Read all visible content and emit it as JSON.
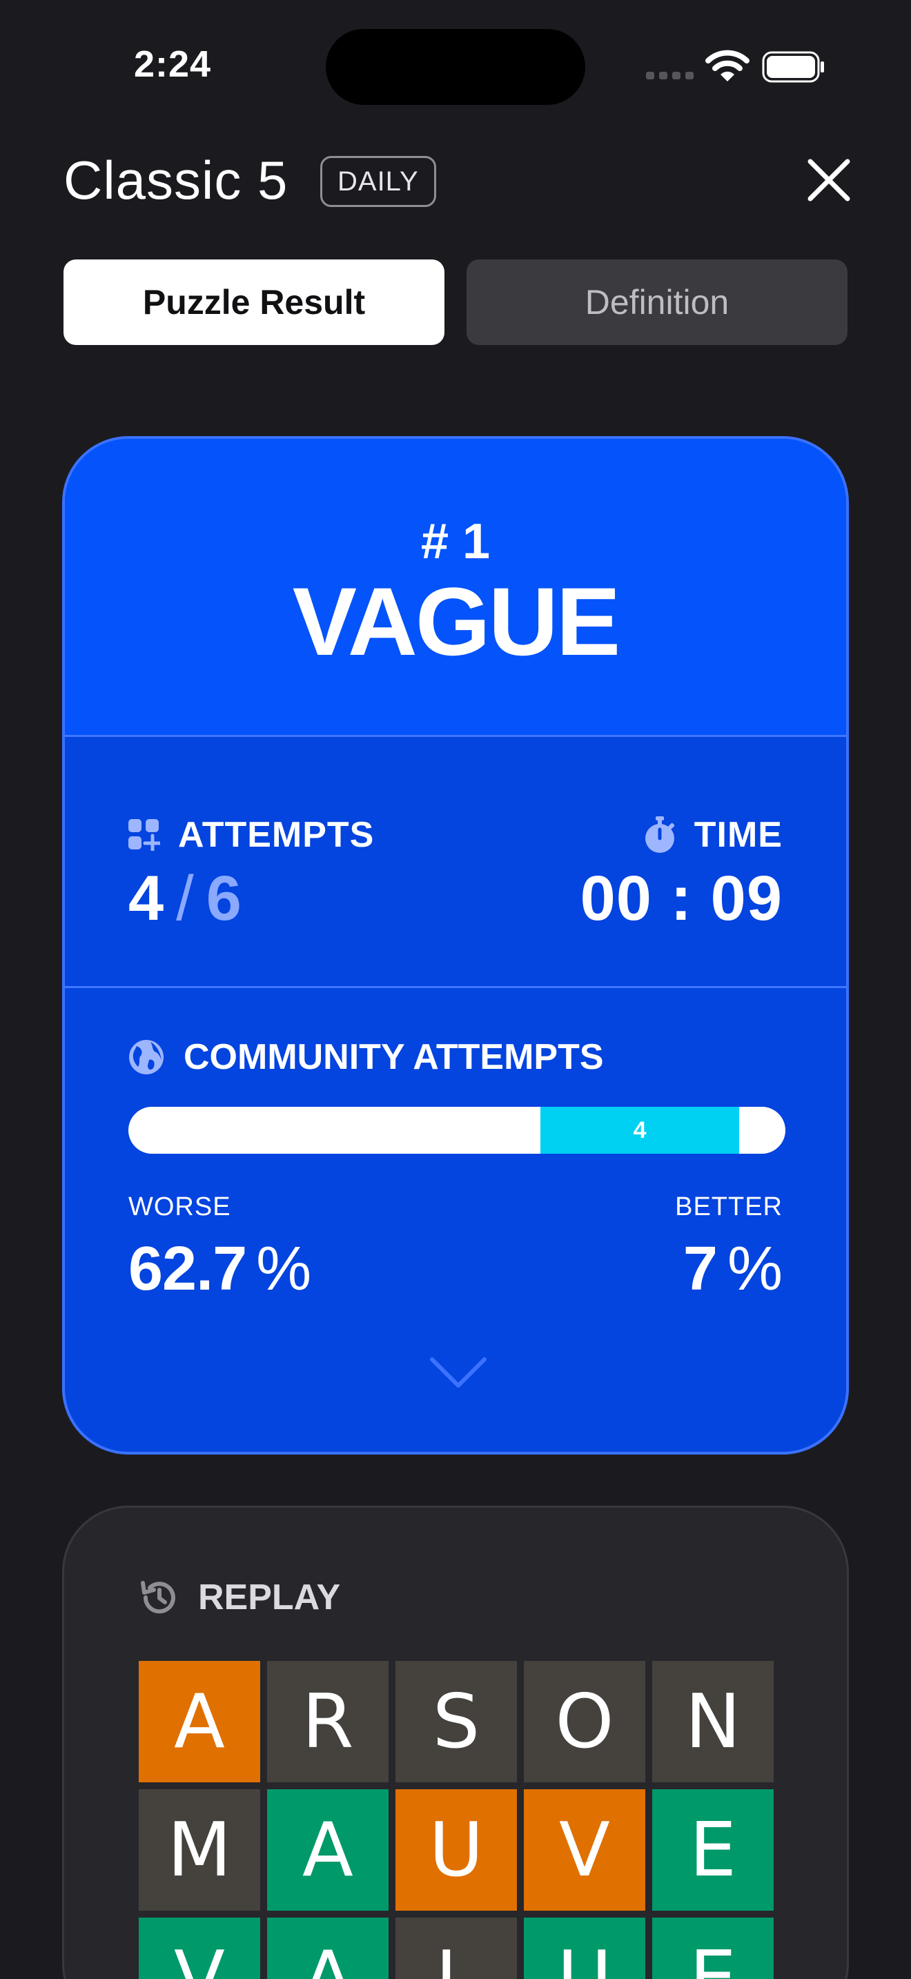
{
  "status_bar": {
    "time": "2:24"
  },
  "header": {
    "title": "Classic 5",
    "badge": "DAILY"
  },
  "tabs": [
    {
      "label": "Puzzle Result",
      "selected": true
    },
    {
      "label": "Definition",
      "selected": false
    }
  ],
  "result": {
    "puzzle_number": "# 1",
    "word": "VAGUE",
    "attempts_label": "ATTEMPTS",
    "attempts_used": "4",
    "attempts_separator": "/",
    "attempts_total": "6",
    "time_label": "TIME",
    "time_value": "00 : 09",
    "community_label": "COMMUNITY ATTEMPTS",
    "community_marker": "4",
    "community_worse_fraction": 0.627,
    "community_better_fraction": 0.07,
    "worse_label": "WORSE",
    "worse_value": "62.7",
    "better_label": "BETTER",
    "better_value": "7",
    "percent_sign": "%"
  },
  "replay": {
    "label": "REPLAY",
    "rows": [
      [
        {
          "letter": "A",
          "state": "orange"
        },
        {
          "letter": "R",
          "state": "gray"
        },
        {
          "letter": "S",
          "state": "gray"
        },
        {
          "letter": "O",
          "state": "gray"
        },
        {
          "letter": "N",
          "state": "gray"
        }
      ],
      [
        {
          "letter": "M",
          "state": "gray"
        },
        {
          "letter": "A",
          "state": "green"
        },
        {
          "letter": "U",
          "state": "orange"
        },
        {
          "letter": "V",
          "state": "orange"
        },
        {
          "letter": "E",
          "state": "green"
        }
      ],
      [
        {
          "letter": "V",
          "state": "green"
        },
        {
          "letter": "A",
          "state": "green"
        },
        {
          "letter": "L",
          "state": "gray"
        },
        {
          "letter": "U",
          "state": "green"
        },
        {
          "letter": "E",
          "state": "green"
        }
      ]
    ]
  },
  "colors": {
    "background": "#1b1b1f",
    "card_blue": "#0444df",
    "card_blue_top": "#0453fb",
    "bar_fill": "#00d1f2",
    "tile_gray": "#45423e",
    "tile_orange": "#e07000",
    "tile_green": "#00996a"
  },
  "icons": [
    "wifi-icon",
    "battery-icon",
    "close-icon",
    "attempts-grid-icon",
    "stopwatch-icon",
    "globe-icon",
    "chevron-down-icon",
    "history-icon"
  ]
}
